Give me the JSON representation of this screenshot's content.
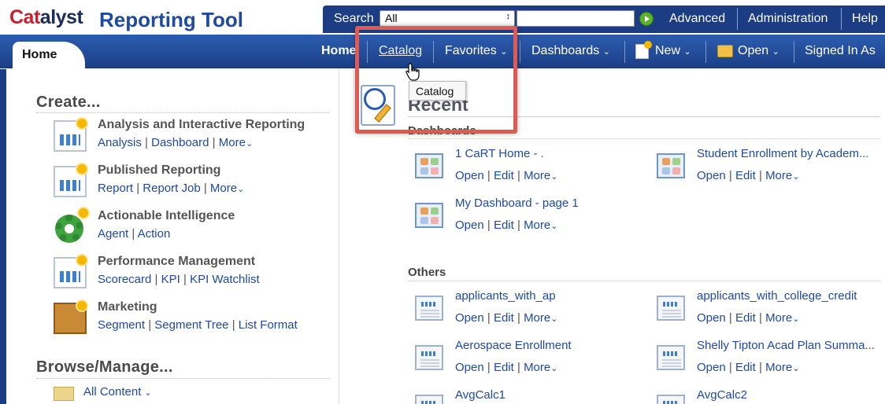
{
  "header": {
    "brand": {
      "part1": "Cat",
      "part2": "alyst"
    },
    "product": "Reporting Tool",
    "search_label": "Search",
    "search_scope": "All",
    "search_value": "",
    "links": [
      "Advanced",
      "Administration",
      "Help"
    ]
  },
  "nav": {
    "home_tab": "Home",
    "home_link": "Home",
    "catalog": "Catalog",
    "favorites": "Favorites",
    "dashboards": "Dashboards",
    "new": "New",
    "open": "Open",
    "signed_in": "Signed In As"
  },
  "tooltip": "Catalog",
  "create": {
    "title": "Create...",
    "items": [
      {
        "title": "Analysis and Interactive Reporting",
        "links": [
          "Analysis",
          "Dashboard"
        ],
        "more": "More"
      },
      {
        "title": "Published Reporting",
        "links": [
          "Report",
          "Report Job"
        ],
        "more": "More"
      },
      {
        "title": "Actionable Intelligence",
        "links": [
          "Agent",
          "Action"
        ]
      },
      {
        "title": "Performance Management",
        "links": [
          "Scorecard",
          "KPI",
          "KPI Watchlist"
        ]
      },
      {
        "title": "Marketing",
        "links": [
          "Segment",
          "Segment Tree",
          "List Format"
        ]
      }
    ]
  },
  "browse": {
    "title": "Browse/Manage...",
    "all_content": "All Content"
  },
  "recent": {
    "title": "Recent",
    "dashboards_label": "Dashboards",
    "others_label": "Others",
    "actions": {
      "open": "Open",
      "edit": "Edit",
      "more": "More"
    },
    "dashboards": [
      "1 CaRT Home - .",
      "Student Enrollment by Academ...",
      "My Dashboard - page 1"
    ],
    "others": [
      "applicants_with_ap",
      "applicants_with_college_credit",
      "Aerospace Enrollment",
      "Shelly Tipton Acad Plan Summa...",
      "AvgCalc1",
      "AvgCalc2"
    ]
  }
}
